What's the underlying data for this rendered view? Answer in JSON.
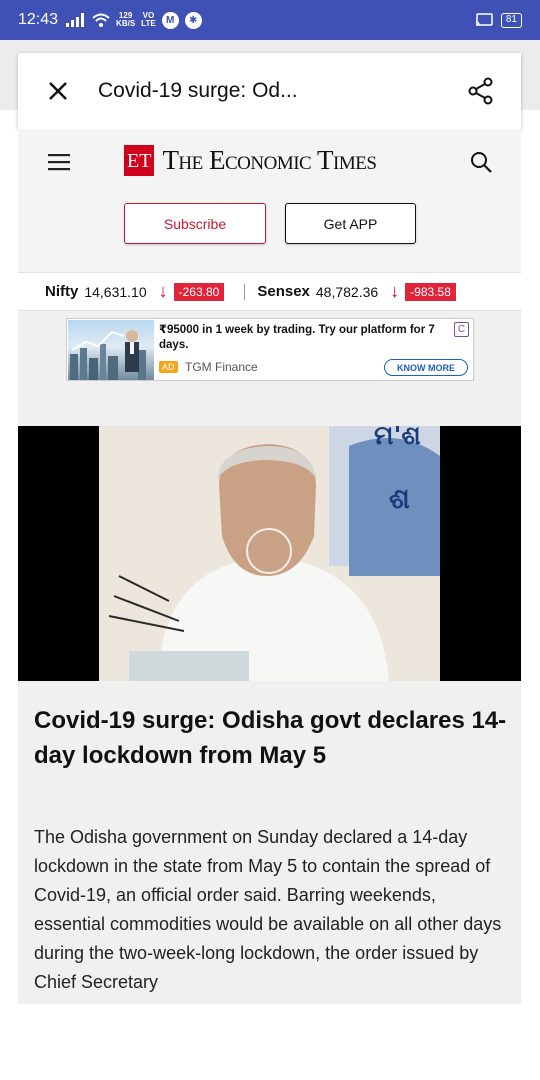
{
  "status_bar": {
    "time": "12:43",
    "net_speed": "129",
    "net_unit": "KB/S",
    "net_type_top": "VO",
    "net_type_bottom": "LTE",
    "battery": "81"
  },
  "app_bar": {
    "title": "Covid-19 surge: Od..."
  },
  "site_header": {
    "logo_mark": "ET",
    "logo_name": "The Economic Times",
    "subscribe_label": "Subscribe",
    "get_app_label": "Get APP"
  },
  "market_ticker": [
    {
      "name": "Nifty",
      "value": "14,631.10",
      "change": "-263.80"
    },
    {
      "name": "Sensex",
      "value": "48,782.36",
      "change": "-983.58"
    }
  ],
  "ad": {
    "text": "₹95000 in 1 week by trading. Try our platform for 7 days.",
    "badge": "AD",
    "source": "TGM Finance",
    "cta": "KNOW MORE",
    "close": "C"
  },
  "article": {
    "headline": "Covid-19 surge: Odisha govt declares 14-day lockdown from May 5",
    "body": "The Odisha government on Sunday declared a 14-day lockdown in the state from May 5 to contain the spread of Covid-19, an official order said. Barring weekends, essential commodities would be available on all other days during the two-week-long lockdown, the order issued by Chief Secretary"
  },
  "colors": {
    "status_bar": "#3f51b5",
    "brand_red": "#d0021b",
    "ad_cta_blue": "#1e5fbf"
  }
}
